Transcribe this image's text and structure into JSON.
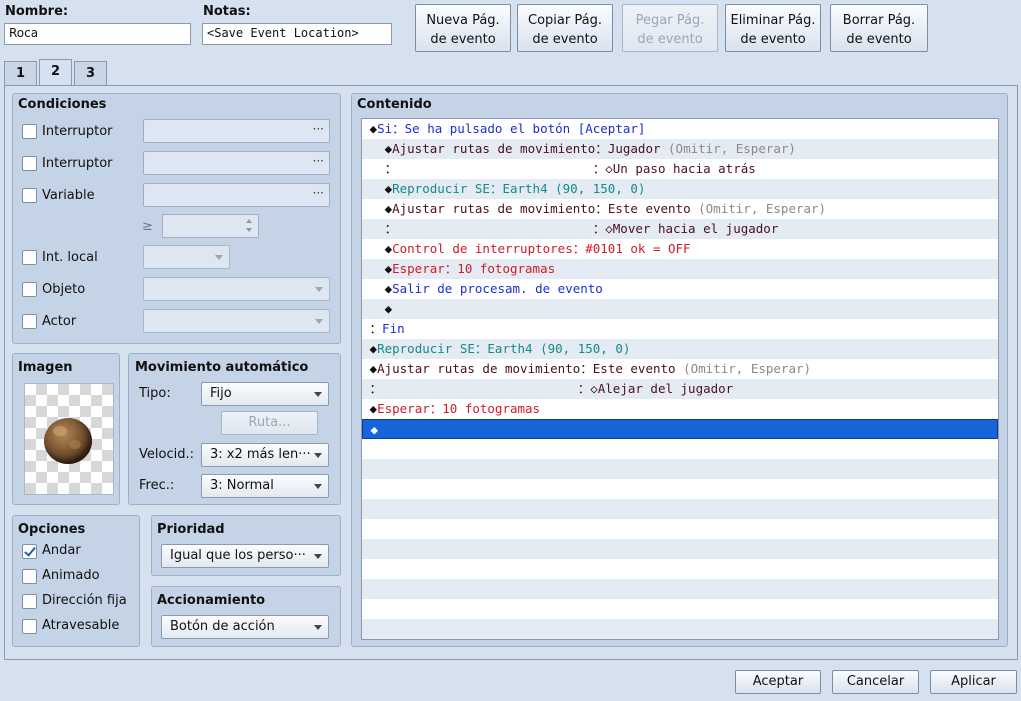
{
  "header": {
    "name_label": "Nombre:",
    "name_value": "Roca",
    "notes_label": "Notas:",
    "notes_value": "<Save Event Location>"
  },
  "page_buttons": {
    "new": [
      "Nueva Pág.",
      "de evento"
    ],
    "copy": [
      "Copiar Pág.",
      "de evento"
    ],
    "paste": [
      "Pegar Pág.",
      "de evento"
    ],
    "delete": [
      "Eliminar Pág.",
      "de evento"
    ],
    "clear": [
      "Borrar Pág.",
      "de evento"
    ]
  },
  "tabs": [
    "1",
    "2",
    "3"
  ],
  "active_tab": "2",
  "conditions": {
    "title": "Condiciones",
    "switch1": "Interruptor",
    "switch2": "Interruptor",
    "variable": "Variable",
    "gte": "≥",
    "self_switch": "Int. local",
    "item": "Objeto",
    "actor": "Actor",
    "dots": "···"
  },
  "image": {
    "title": "Imagen",
    "icon": "rock-sprite"
  },
  "autonomous": {
    "title": "Movimiento automático",
    "type_label": "Tipo:",
    "type_value": "Fijo",
    "route_button": "Ruta...",
    "speed_label": "Velocid.:",
    "speed_value": "3: x2 más len···",
    "freq_label": "Frec.:",
    "freq_value": "3: Normal"
  },
  "options": {
    "title": "Opciones",
    "walking": "Andar",
    "walking_checked": true,
    "stepping": "Animado",
    "direction_fix": "Dirección fija",
    "through": "Atravesable"
  },
  "priority": {
    "title": "Prioridad",
    "value": "Igual que los perso···"
  },
  "trigger": {
    "title": "Accionamiento",
    "value": "Botón de acción"
  },
  "contents": {
    "title": "Contenido",
    "rows": [
      {
        "indent": "",
        "parts": [
          [
            "◆",
            "c-black"
          ],
          [
            "Si：Se ha pulsado el botón [Aceptar]",
            "c-blue"
          ]
        ]
      },
      {
        "indent": "  ",
        "parts": [
          [
            "◆",
            "c-black"
          ],
          [
            "Ajustar rutas de movimiento：",
            "c-dark"
          ],
          [
            "Jugador",
            "c-dark"
          ],
          [
            " (Omitir, Esperar)",
            "c-gray"
          ]
        ]
      },
      {
        "indent": "  ",
        "parts": [
          [
            "：",
            "c-black"
          ],
          [
            "                          ：◇Un paso hacia atrás",
            "c-dark"
          ]
        ]
      },
      {
        "indent": "  ",
        "parts": [
          [
            "◆",
            "c-black"
          ],
          [
            "Reproducir SE：Earth4 (90, 150, 0)",
            "c-teal"
          ]
        ]
      },
      {
        "indent": "  ",
        "parts": [
          [
            "◆",
            "c-black"
          ],
          [
            "Ajustar rutas de movimiento：",
            "c-dark"
          ],
          [
            "Este evento",
            "c-dark"
          ],
          [
            " (Omitir, Esperar)",
            "c-gray"
          ]
        ]
      },
      {
        "indent": "  ",
        "parts": [
          [
            "：",
            "c-black"
          ],
          [
            "                          ：◇Mover hacia el jugador",
            "c-dark"
          ]
        ]
      },
      {
        "indent": "  ",
        "parts": [
          [
            "◆",
            "c-black"
          ],
          [
            "Control de interruptores：#0101 ok = OFF",
            "c-red"
          ]
        ]
      },
      {
        "indent": "  ",
        "parts": [
          [
            "◆",
            "c-black"
          ],
          [
            "Esperar：10 fotogramas",
            "c-red"
          ]
        ]
      },
      {
        "indent": "  ",
        "parts": [
          [
            "◆",
            "c-black"
          ],
          [
            "Salir de procesam. de evento",
            "c-blue"
          ]
        ]
      },
      {
        "indent": "  ",
        "parts": [
          [
            "◆",
            "c-black"
          ]
        ]
      },
      {
        "indent": "",
        "parts": [
          [
            "：",
            "c-black"
          ],
          [
            "Fin",
            "c-blue"
          ]
        ]
      },
      {
        "indent": "",
        "parts": [
          [
            "◆",
            "c-black"
          ],
          [
            "Reproducir SE：Earth4 (90, 150, 0)",
            "c-teal"
          ]
        ]
      },
      {
        "indent": "",
        "parts": [
          [
            "◆",
            "c-black"
          ],
          [
            "Ajustar rutas de movimiento：",
            "c-dark"
          ],
          [
            "Este evento",
            "c-dark"
          ],
          [
            " (Omitir, Esperar)",
            "c-gray"
          ]
        ]
      },
      {
        "indent": "",
        "parts": [
          [
            "：",
            "c-black"
          ],
          [
            "                          ：◇Alejar del jugador",
            "c-dark"
          ]
        ]
      },
      {
        "indent": "",
        "parts": [
          [
            "◆",
            "c-black"
          ],
          [
            "Esperar：10 fotogramas",
            "c-red"
          ]
        ]
      },
      {
        "indent": "",
        "parts": [
          [
            "◆",
            "c-white"
          ]
        ],
        "selected": true
      }
    ],
    "empty_rows": 10
  },
  "footer": {
    "ok": "Aceptar",
    "cancel": "Cancelar",
    "apply": "Aplicar"
  },
  "colors": {
    "selection": "#1565d8",
    "panel": "#c4d3e6",
    "window": "#d6e1ef"
  }
}
